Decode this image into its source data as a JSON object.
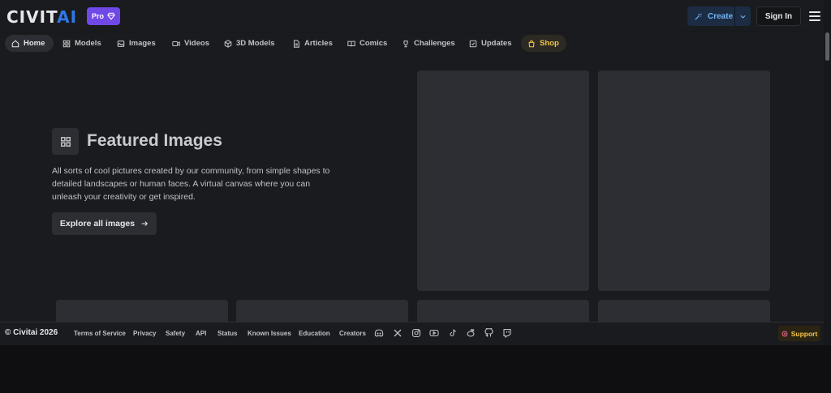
{
  "header": {
    "logo": {
      "civit": "CIVIT",
      "ai": "AI"
    },
    "pro_badge": "Pro",
    "create_label": "Create",
    "signin_label": "Sign In",
    "accent_color": "#2f77e6",
    "pro_color": "#7048e8"
  },
  "nav": {
    "items": [
      {
        "label": "Home",
        "icon": "home-icon"
      },
      {
        "label": "Models",
        "icon": "grid-icon"
      },
      {
        "label": "Images",
        "icon": "image-icon"
      },
      {
        "label": "Videos",
        "icon": "video-icon"
      },
      {
        "label": "3D Models",
        "icon": "cube-icon"
      },
      {
        "label": "Articles",
        "icon": "article-icon"
      },
      {
        "label": "Comics",
        "icon": "book-icon"
      },
      {
        "label": "Challenges",
        "icon": "trophy-icon"
      },
      {
        "label": "Updates",
        "icon": "updates-icon"
      },
      {
        "label": "Shop",
        "icon": "shopping-bag-icon"
      }
    ],
    "active": "Home",
    "shop_color": "#f3c54b"
  },
  "featured": {
    "title": "Featured Images",
    "description": "All sorts of cool pictures created by our community, from simple shapes to detailed landscapes or human faces. A virtual canvas where you can unleash your creativity or get inspired.",
    "button_label": "Explore all images"
  },
  "footer": {
    "copyright": "© Civitai 2026",
    "links": [
      "Terms of Service",
      "Privacy",
      "Safety",
      "API",
      "Status",
      "Known Issues",
      "Education",
      "Creators"
    ],
    "social_icons": [
      "discord-icon",
      "x-icon",
      "instagram-icon",
      "youtube-icon",
      "tiktok-icon",
      "reddit-icon",
      "github-icon",
      "twitch-icon"
    ],
    "support_label": "Support"
  }
}
